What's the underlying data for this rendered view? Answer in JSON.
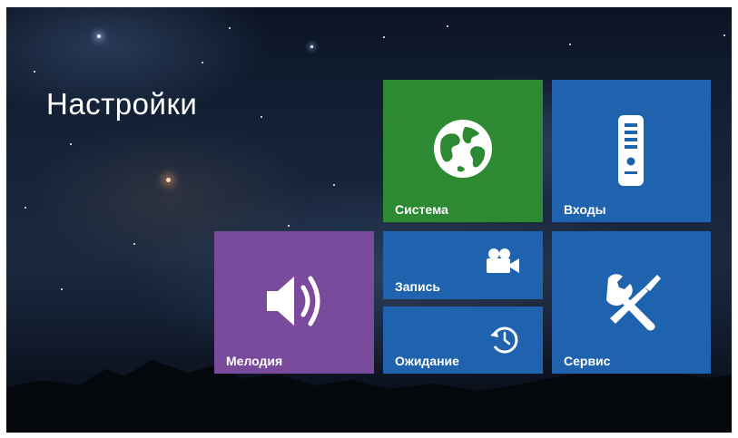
{
  "page": {
    "title": "Настройки"
  },
  "tiles": {
    "system": {
      "label": "Система",
      "icon": "globe-icon",
      "color": "#2d8a33"
    },
    "inputs": {
      "label": "Входы",
      "icon": "door-panel-icon",
      "color": "#1f62ad"
    },
    "melody": {
      "label": "Мелодия",
      "icon": "speaker-icon",
      "color": "#7a4b9c"
    },
    "record": {
      "label": "Запись",
      "icon": "video-camera-icon",
      "color": "#1f62ad"
    },
    "standby": {
      "label": "Ожидание",
      "icon": "timer-icon",
      "color": "#1f62ad"
    },
    "service": {
      "label": "Сервис",
      "icon": "tools-icon",
      "color": "#1f62ad"
    }
  }
}
